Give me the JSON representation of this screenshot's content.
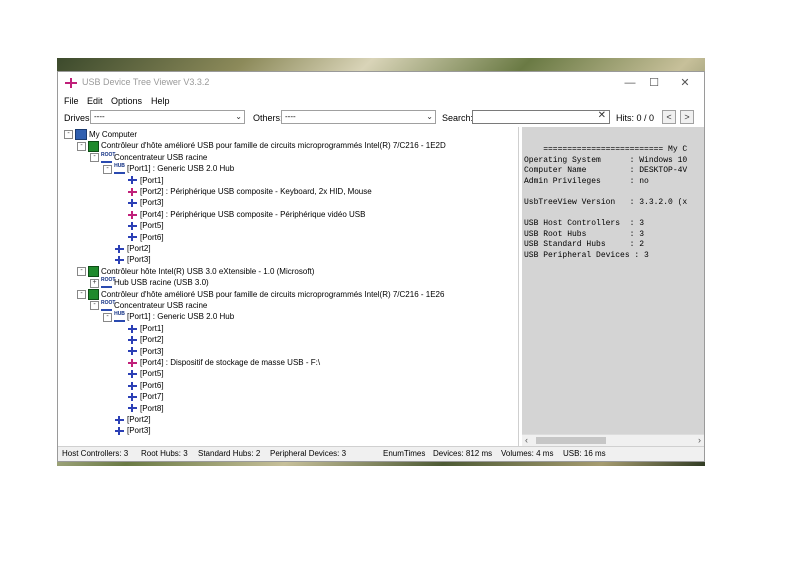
{
  "window": {
    "title": "USB Device Tree Viewer V3.3.2",
    "controls": [
      "—",
      "☐",
      "✕"
    ]
  },
  "menu": [
    "File",
    "Edit",
    "Options",
    "Help"
  ],
  "toolbar": {
    "drives_label": "Drives:",
    "drives_value": "----",
    "others_label": "Others:",
    "others_value": "----",
    "search_label": "Search:",
    "search_value": "",
    "hits": "Hits: 0 / 0",
    "prev": "<",
    "next": ">"
  },
  "tree": [
    {
      "level": 0,
      "icon": "pc",
      "expander": "-",
      "label": "My Computer"
    },
    {
      "level": 1,
      "icon": "chip",
      "expander": "-",
      "label": "Contrôleur d'hôte amélioré USB pour famille de circuits microprogrammés Intel(R) 7/C216 - 1E2D"
    },
    {
      "level": 2,
      "icon": "root",
      "expander": "-",
      "label": "Concentrateur USB racine"
    },
    {
      "level": 3,
      "icon": "hub",
      "expander": "-",
      "label": "[Port1] : Generic USB 2.0 Hub"
    },
    {
      "level": 4,
      "icon": "port",
      "expander": "",
      "label": "[Port1]"
    },
    {
      "level": 4,
      "icon": "dev",
      "expander": "",
      "label": "[Port2] : Périphérique USB composite - Keyboard, 2x HID, Mouse"
    },
    {
      "level": 4,
      "icon": "port",
      "expander": "",
      "label": "[Port3]"
    },
    {
      "level": 4,
      "icon": "dev",
      "expander": "",
      "label": "[Port4] : Périphérique USB composite - Périphérique vidéo USB"
    },
    {
      "level": 4,
      "icon": "port",
      "expander": "",
      "label": "[Port5]"
    },
    {
      "level": 4,
      "icon": "port",
      "expander": "",
      "label": "[Port6]"
    },
    {
      "level": 3,
      "icon": "port",
      "expander": "",
      "label": "[Port2]"
    },
    {
      "level": 3,
      "icon": "port",
      "expander": "",
      "label": "[Port3]"
    },
    {
      "level": 1,
      "icon": "chip",
      "expander": "-",
      "label": "Contrôleur hôte Intel(R) USB 3.0 eXtensible - 1.0 (Microsoft)"
    },
    {
      "level": 2,
      "icon": "root",
      "expander": "+",
      "label": "Hub USB racine (USB 3.0)"
    },
    {
      "level": 1,
      "icon": "chip",
      "expander": "-",
      "label": "Contrôleur d'hôte amélioré USB pour famille de circuits microprogrammés Intel(R) 7/C216 - 1E26"
    },
    {
      "level": 2,
      "icon": "root",
      "expander": "-",
      "label": "Concentrateur USB racine"
    },
    {
      "level": 3,
      "icon": "hub",
      "expander": "-",
      "label": "[Port1] : Generic USB 2.0 Hub"
    },
    {
      "level": 4,
      "icon": "port",
      "expander": "",
      "label": "[Port1]"
    },
    {
      "level": 4,
      "icon": "port",
      "expander": "",
      "label": "[Port2]"
    },
    {
      "level": 4,
      "icon": "port",
      "expander": "",
      "label": "[Port3]"
    },
    {
      "level": 4,
      "icon": "dev",
      "expander": "",
      "label": "[Port4] : Dispositif de stockage de masse USB - F:\\"
    },
    {
      "level": 4,
      "icon": "port",
      "expander": "",
      "label": "[Port5]"
    },
    {
      "level": 4,
      "icon": "port",
      "expander": "",
      "label": "[Port6]"
    },
    {
      "level": 4,
      "icon": "port",
      "expander": "",
      "label": "[Port7]"
    },
    {
      "level": 4,
      "icon": "port",
      "expander": "",
      "label": "[Port8]"
    },
    {
      "level": 3,
      "icon": "port",
      "expander": "",
      "label": "[Port2]"
    },
    {
      "level": 3,
      "icon": "port",
      "expander": "",
      "label": "[Port3]"
    }
  ],
  "details": [
    "    ========================= My C",
    "Operating System      : Windows 10",
    "Computer Name         : DESKTOP-4V",
    "Admin Privileges      : no",
    "",
    "UsbTreeView Version   : 3.3.2.0 (x",
    "",
    "USB Host Controllers  : 3",
    "USB Root Hubs         : 3",
    "USB Standard Hubs     : 2",
    "USB Peripheral Devices : 3"
  ],
  "status": {
    "host_controllers": "Host Controllers: 3",
    "root_hubs": "Root Hubs: 3",
    "standard_hubs": "Standard Hubs: 2",
    "peripheral_devices": "Peripheral Devices: 3",
    "enum_times": "EnumTimes",
    "devices": "Devices: 812 ms",
    "volumes": "Volumes: 4 ms",
    "usb": "USB: 16 ms"
  }
}
